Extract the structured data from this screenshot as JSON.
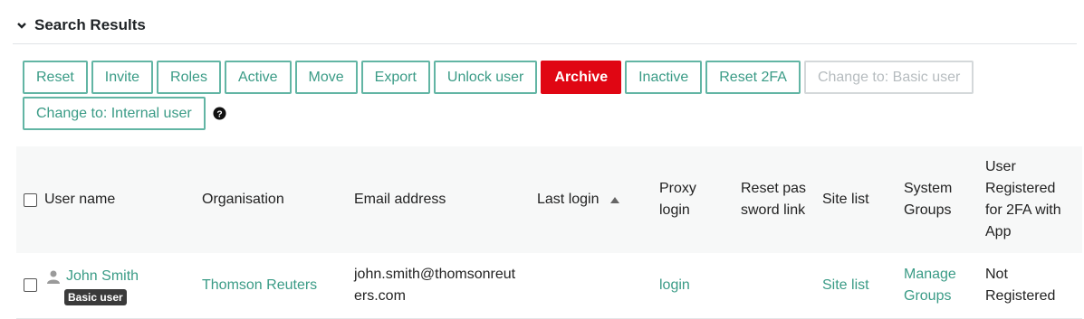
{
  "section": {
    "title": "Search Results"
  },
  "toolbar": {
    "row1": [
      {
        "label": "Reset",
        "state": "normal"
      },
      {
        "label": "Invite",
        "state": "normal"
      },
      {
        "label": "Roles",
        "state": "normal"
      },
      {
        "label": "Active",
        "state": "normal"
      },
      {
        "label": "Move",
        "state": "normal"
      },
      {
        "label": "Export",
        "state": "normal"
      },
      {
        "label": "Unlock user",
        "state": "normal"
      },
      {
        "label": "Archive",
        "state": "danger"
      },
      {
        "label": "Inactive",
        "state": "normal"
      },
      {
        "label": "Reset 2FA",
        "state": "normal"
      },
      {
        "label": "Change to: Basic user",
        "state": "disabled"
      }
    ],
    "row2_button": "Change to: Internal user",
    "help_icon": "question-circle-icon"
  },
  "table": {
    "columns": {
      "user_name": "User name",
      "organisation": "Organisation",
      "email": "Email address",
      "last_login": "Last login",
      "proxy_login": "Proxy login",
      "reset_password": "Reset password link",
      "site_list": "Site list",
      "system_groups": "System Groups",
      "registered_2fa": "User Registered for 2FA with App"
    },
    "rows": [
      {
        "user_name": "John Smith",
        "badge": "Basic user",
        "organisation": "Thomson Reuters",
        "email": "john.smith@thomsonreuters.com",
        "last_login": "",
        "proxy_login": "login",
        "reset_password": "",
        "site_list": "Site list",
        "system_groups": "Manage Groups",
        "registered_2fa": "Not Registered"
      }
    ]
  },
  "colors": {
    "accent": "#3a9b86",
    "danger": "#e00613",
    "disabled": "#b6bcbf"
  }
}
